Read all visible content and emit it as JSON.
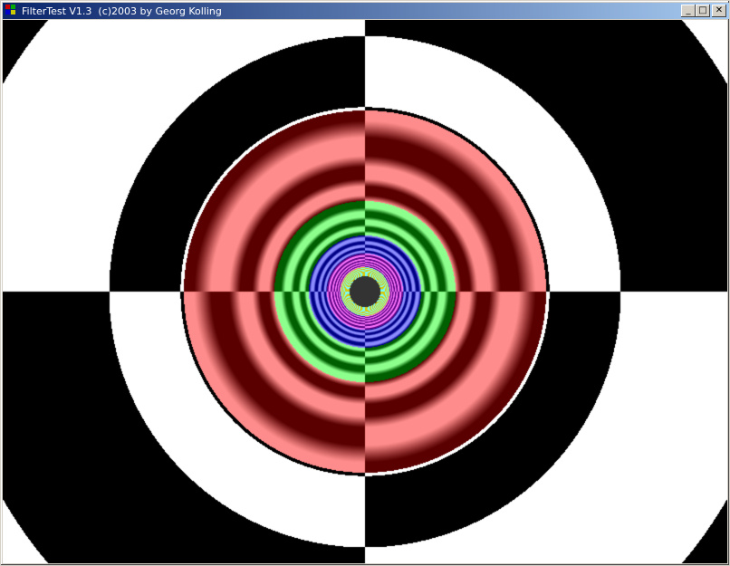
{
  "window": {
    "title": "FilterTest V1.3  (c)2003 by Georg Kolling",
    "buttons": {
      "minimize": "_",
      "maximize": "□",
      "close": "✕"
    }
  },
  "canvas": {
    "pattern": "circular zone plate checkerboard with color filter"
  }
}
